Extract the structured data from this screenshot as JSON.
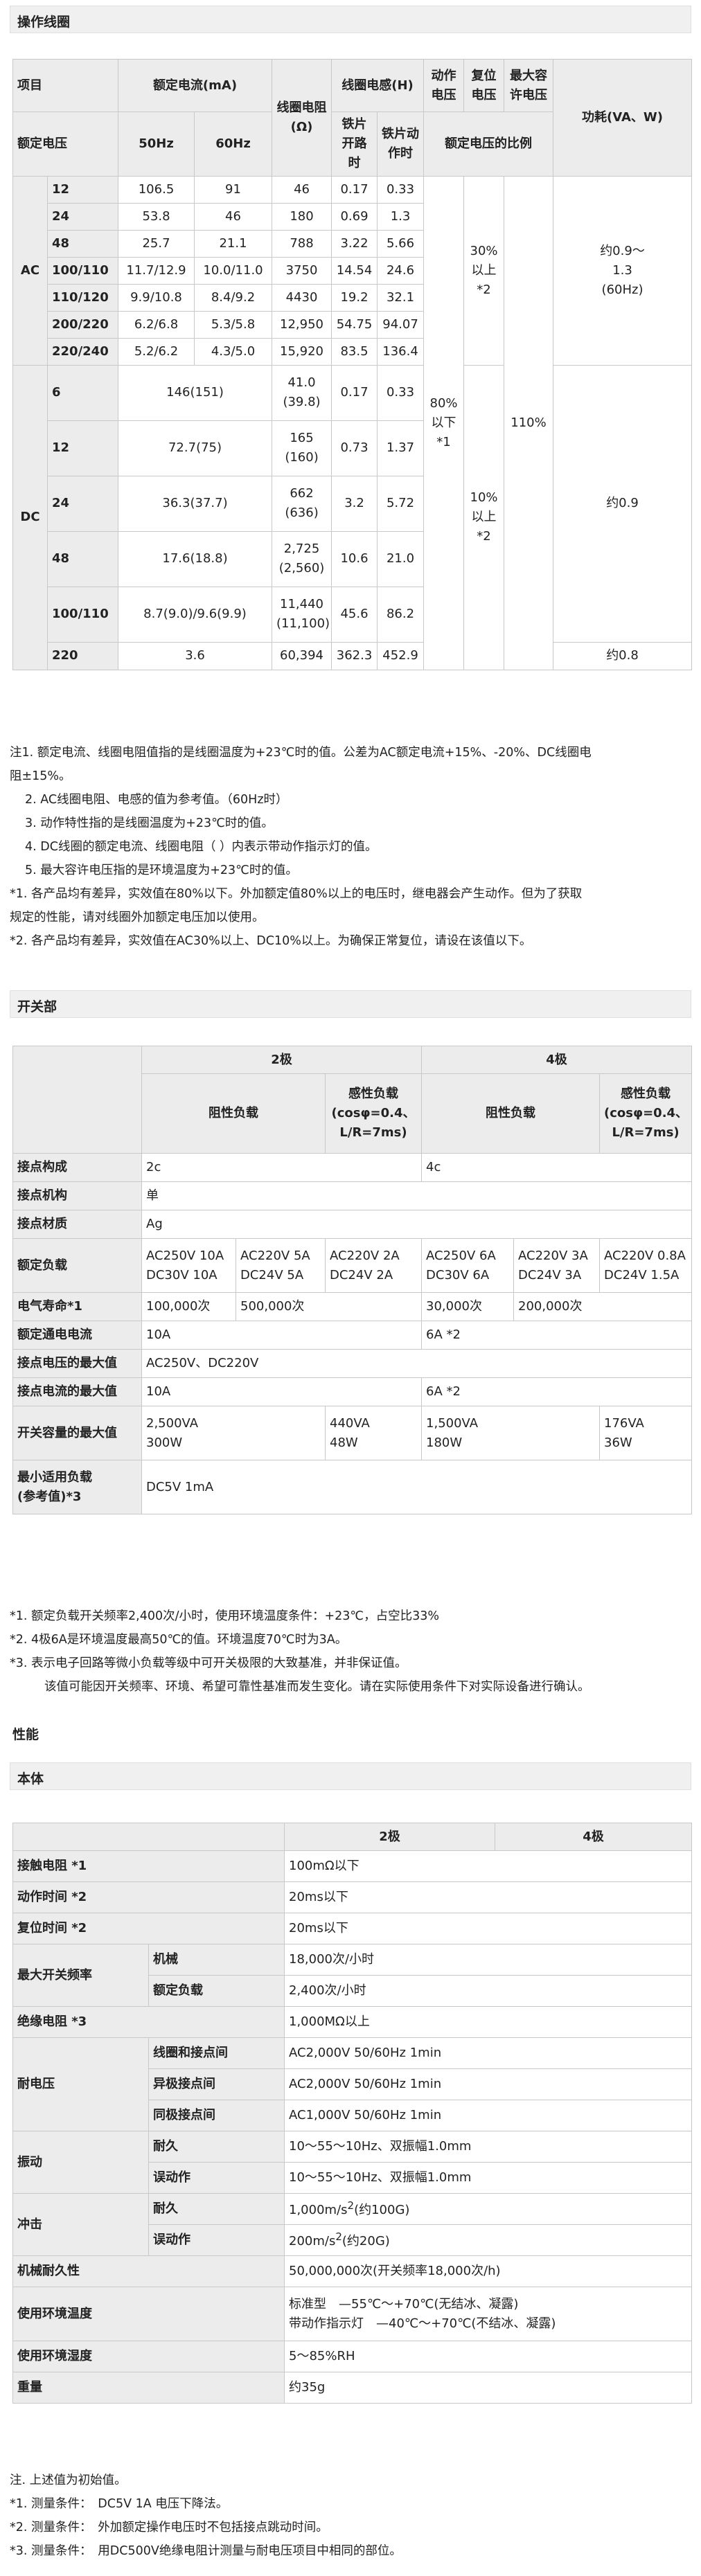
{
  "coil": {
    "title": "操作线圈",
    "head": {
      "item": "项目",
      "rated_current": "额定电流(mA)",
      "resistance": "线圈电阻(Ω)",
      "inductance": "线圈电感(H)",
      "operate_voltage": "动作电压",
      "release_voltage": "复位电压",
      "max_voltage": "最大容许电压",
      "power": "功耗(VA、W)",
      "rated_voltage": "额定电压",
      "hz50": "50Hz",
      "hz60": "60Hz",
      "armature_open": "铁片开路时",
      "armature_closed": "铁片动作时",
      "ratio": "额定电压的比例"
    },
    "ac_label": "AC",
    "dc_label": "DC",
    "ac_rows": [
      {
        "v": "12",
        "c50": "106.5",
        "c60": "91",
        "r": "46",
        "lo": "0.17",
        "lc": "0.33"
      },
      {
        "v": "24",
        "c50": "53.8",
        "c60": "46",
        "r": "180",
        "lo": "0.69",
        "lc": "1.3"
      },
      {
        "v": "48",
        "c50": "25.7",
        "c60": "21.1",
        "r": "788",
        "lo": "3.22",
        "lc": "5.66"
      },
      {
        "v": "100/110",
        "c50": "11.7/12.9",
        "c60": "10.0/11.0",
        "r": "3750",
        "lo": "14.54",
        "lc": "24.6"
      },
      {
        "v": "110/120",
        "c50": "9.9/10.8",
        "c60": "8.4/9.2",
        "r": "4430",
        "lo": "19.2",
        "lc": "32.1"
      },
      {
        "v": "200/220",
        "c50": "6.2/6.8",
        "c60": "5.3/5.8",
        "r": "12,950",
        "lo": "54.75",
        "lc": "94.07"
      },
      {
        "v": "220/240",
        "c50": "5.2/6.2",
        "c60": "4.3/5.0",
        "r": "15,920",
        "lo": "83.5",
        "lc": "136.4"
      }
    ],
    "dc_rows": [
      {
        "v": "6",
        "c": "146(151)",
        "r1": "41.0",
        "r2": "(39.8)",
        "lo": "0.17",
        "lc": "0.33"
      },
      {
        "v": "12",
        "c": "72.7(75)",
        "r1": "165",
        "r2": "(160)",
        "lo": "0.73",
        "lc": "1.37"
      },
      {
        "v": "24",
        "c": "36.3(37.7)",
        "r1": "662",
        "r2": "(636)",
        "lo": "3.2",
        "lc": "5.72"
      },
      {
        "v": "48",
        "c": "17.6(18.8)",
        "r1": "2,725",
        "r2": "(2,560)",
        "lo": "10.6",
        "lc": "21.0"
      },
      {
        "v": "100/110",
        "c": "8.7(9.0)/9.6(9.9)",
        "r1": "11,440",
        "r2": "(11,100)",
        "lo": "45.6",
        "lc": "86.2"
      },
      {
        "v": "220",
        "c": "3.6",
        "r1": "60,394",
        "r2": "",
        "lo": "362.3",
        "lc": "452.9"
      }
    ],
    "operate_val": [
      "80%",
      "以下",
      "*1"
    ],
    "ac_release": [
      "30%",
      "以上",
      "*2"
    ],
    "dc_release": [
      "10%",
      "以上",
      "*2"
    ],
    "max_val": "110%",
    "ac_power": [
      "约0.9～",
      "1.3",
      "(60Hz)"
    ],
    "dc_power": "约0.9",
    "dc220_power": "约0.8",
    "notes": [
      "注1. 额定电流、线圈电阻值指的是线圈温度为+23℃时的值。公差为AC额定电流+15%、-20%、DC线圈电",
      "阻±15%。",
      "2. AC线圈电阻、电感的值为参考值。（60Hz时）",
      "3. 动作特性指的是线圈温度为+23℃时的值。",
      "4. DC线圈的额定电流、线圈电阻（ ）内表示带动作指示灯的值。",
      "5. 最大容许电压指的是环境温度为+23℃时的值。",
      "*1. 各产品均有差异，实效值在80%以下。外加额定值80%以上的电压时，继电器会产生动作。但为了获取",
      "规定的性能，请对线圈外加额定电压加以使用。",
      "*2. 各产品均有差异，实效值在AC30%以上、DC10%以上。为确保正常复位，请设在该值以下。"
    ]
  },
  "switch": {
    "title": "开关部",
    "pole2": "2极",
    "pole4": "4极",
    "resistive": "阻性负载",
    "inductive": [
      "感性负载",
      "(cosφ=0.4、",
      "L/R=7ms)"
    ],
    "rows": {
      "contact_form": {
        "label": "接点构成",
        "p2": "2c",
        "p4": "4c"
      },
      "mechanism": {
        "label": "接点机构",
        "v": "单"
      },
      "material": {
        "label": "接点材质",
        "v": "Ag"
      },
      "rated_load": {
        "label": "额定负载",
        "p2r1": "AC250V 10A",
        "p2r2": "DC30V 10A",
        "p2i1a": "AC220V 5A",
        "p2i1b": "DC24V 5A",
        "p2i2a": "AC220V 2A",
        "p2i2b": "DC24V 2A",
        "p4r1": "AC250V 6A",
        "p4r2": "DC30V 6A",
        "p4i1a": "AC220V 3A",
        "p4i1b": "DC24V 3A",
        "p4i2a": "AC220V 0.8A",
        "p4i2b": "DC24V 1.5A"
      },
      "life": {
        "label": "电气寿命*1",
        "p2r": "100,000次",
        "p2i": "500,000次",
        "p4r": "30,000次",
        "p4i": "200,000次"
      },
      "rated_carry": {
        "label": "额定通电电流",
        "p2": "10A",
        "p4": "6A *2"
      },
      "max_voltage": {
        "label": "接点电压的最大值",
        "v": "AC250V、DC220V"
      },
      "max_current": {
        "label": "接点电流的最大值",
        "p2": "10A",
        "p4": "6A *2"
      },
      "max_capacity": {
        "label": "开关容量的最大值",
        "p2r1": "2,500VA",
        "p2r2": "300W",
        "p2i1": "440VA",
        "p2i2": "48W",
        "p4r1": "1,500VA",
        "p4r2": "180W",
        "p4i1": "176VA",
        "p4i2": "36W"
      },
      "min_load": {
        "label1": "最小适用负载",
        "label2": "(参考值)*3",
        "v": "DC5V 1mA"
      }
    },
    "notes": [
      "*1. 额定负载开关频率2,400次/小时，使用环境温度条件：+23℃，占空比33%",
      "*2. 4极6A是环境温度最高50℃的值。环境温度70℃时为3A。",
      "*3. 表示电子回路等微小负载等级中可开关极限的大致基准，并非保证值。",
      "该值可能因开关频率、环境、希望可靠性基准而发生变化。请在实际使用条件下对实际设备进行确认。"
    ]
  },
  "perf": {
    "title": "性能",
    "body_title": "本体",
    "pole2": "2极",
    "pole4": "4极",
    "rows": {
      "contact_resistance": {
        "label": "接触电阻 *1",
        "v": "100mΩ以下"
      },
      "operate_time": {
        "label": "动作时间 *2",
        "v": "20ms以下"
      },
      "release_time": {
        "label": "复位时间 *2",
        "v": "20ms以下"
      },
      "max_freq": {
        "label": "最大开关频率",
        "mech": "机械",
        "mech_v": "18,000次/小时",
        "rated": "额定负载",
        "rated_v": "2,400次/小时"
      },
      "insulation": {
        "label": "绝缘电阻 *3",
        "v": "1,000MΩ以上"
      },
      "dielectric": {
        "label": "耐电压",
        "a": "线圈和接点间",
        "a_v": "AC2,000V 50/60Hz 1min",
        "b": "异极接点间",
        "b_v": "AC2,000V 50/60Hz 1min",
        "c": "同极接点间",
        "c_v": "AC1,000V 50/60Hz 1min"
      },
      "vibration": {
        "label": "振动",
        "a": "耐久",
        "a_v": "10～55～10Hz、双振幅1.0mm",
        "b": "误动作",
        "b_v": "10～55～10Hz、双振幅1.0mm"
      },
      "shock": {
        "label": "冲击",
        "a": "耐久",
        "a_v1": "1,000m/s",
        "a_v2": "2",
        "a_v3": "(约100G)",
        "b": "误动作",
        "b_v1": "200m/s",
        "b_v2": "2",
        "b_v3": "(约20G)"
      },
      "mech_life": {
        "label": "机械耐久性",
        "v": "50,000,000次(开关频率18,000次/h)"
      },
      "ambient_temp": {
        "label": "使用环境温度",
        "v1": "标准型　—55℃～+70℃(无结冰、凝露)",
        "v2": "带动作指示灯　—40℃～+70℃(不结冰、凝露)"
      },
      "ambient_humidity": {
        "label": "使用环境湿度",
        "v": "5～85%RH"
      },
      "weight": {
        "label": "重量",
        "v": "约35g"
      }
    },
    "notes": [
      "注. 上述值为初始值。",
      "*1. 测量条件：　DC5V 1A 电压下降法。",
      "*2. 测量条件：　外加额定操作电压时不包括接点跳动时间。",
      "*3. 测量条件：　用DC500V绝缘电阻计测量与耐电压项目中相同的部位。"
    ]
  }
}
